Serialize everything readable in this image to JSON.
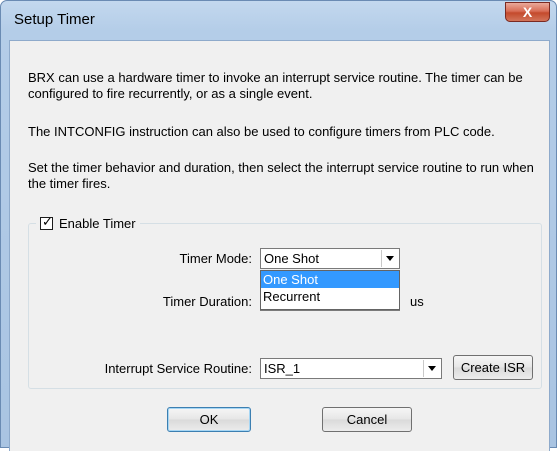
{
  "window": {
    "title": "Setup Timer",
    "close_label": "X"
  },
  "description": {
    "paragraph1": "BRX can use a hardware timer to invoke an interrupt service routine. The timer can be configured to fire recurrently, or as a single event.",
    "paragraph2": "The INTCONFIG instruction can also be used to configure timers from PLC code.",
    "paragraph3": "Set the timer behavior and duration, then select the interrupt service routine to run when the timer fires."
  },
  "group": {
    "enable_label": "Enable Timer",
    "enable_checked": true,
    "check_glyph": "✓"
  },
  "timer_mode": {
    "label": "Timer Mode:",
    "value": "One Shot",
    "options": [
      "One Shot",
      "Recurrent"
    ],
    "highlighted": "One Shot"
  },
  "timer_duration": {
    "label": "Timer Duration:",
    "value": "",
    "unit": "us"
  },
  "isr": {
    "label": "Interrupt Service Routine:",
    "value": "ISR_1",
    "create_button": "Create ISR"
  },
  "buttons": {
    "ok": "OK",
    "cancel": "Cancel"
  }
}
